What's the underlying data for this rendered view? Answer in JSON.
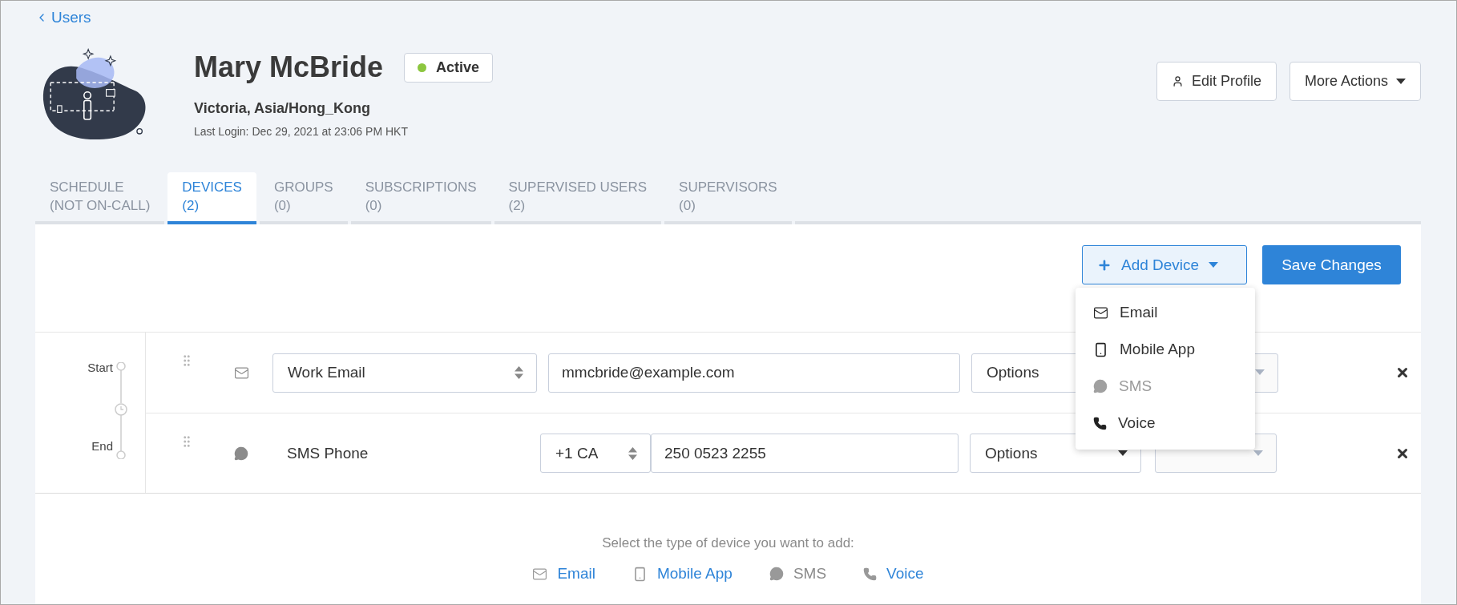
{
  "back_link": "Users",
  "profile": {
    "name": "Mary McBride",
    "status": {
      "label": "Active",
      "color": "#8cc63f"
    },
    "location": "Victoria, Asia/Hong_Kong",
    "last_login": "Last Login: Dec 29, 2021 at 23:06 PM HKT"
  },
  "header_buttons": [
    {
      "label": "Edit Profile",
      "kind": "icon"
    },
    {
      "label": "More Actions",
      "kind": "menu"
    }
  ],
  "tabs": [
    {
      "label": "SCHEDULE",
      "count": "(NOT ON-CALL)",
      "selected": false
    },
    {
      "label": "DEVICES",
      "count": "(2)",
      "selected": true
    },
    {
      "label": "GROUPS",
      "count": "(0)",
      "selected": false
    },
    {
      "label": "SUBSCRIPTIONS",
      "count": "(0)",
      "selected": false
    },
    {
      "label": "SUPERVISED USERS",
      "count": "(2)",
      "selected": false
    },
    {
      "label": "SUPERVISORS",
      "count": "(0)",
      "selected": false
    }
  ],
  "toolbar": {
    "add_button": "Add Device",
    "save_button": "Save Changes",
    "menu_expanded": true
  },
  "add_menu": [
    {
      "label": "Email",
      "kind": "email",
      "disabled": false
    },
    {
      "label": "Mobile App",
      "kind": "mobile",
      "disabled": false
    },
    {
      "label": "SMS",
      "kind": "sms",
      "disabled": true
    },
    {
      "label": "Voice",
      "kind": "voice",
      "disabled": false
    }
  ],
  "timeline": {
    "start": "Start",
    "end": "End"
  },
  "devices": [
    {
      "kind": "email",
      "name": "Work Email",
      "value": "mmcbride@example.com",
      "options": "Options"
    },
    {
      "kind": "sms",
      "name": "SMS Phone",
      "country": "+1 CA",
      "value": "250 0523 2255",
      "options": "Options"
    }
  ],
  "add_prompt": "Select the type of device you want to add:",
  "add_links": [
    {
      "label": "Email",
      "kind": "email",
      "disabled": false
    },
    {
      "label": "Mobile App",
      "kind": "mobile",
      "disabled": false
    },
    {
      "label": "SMS",
      "kind": "sms",
      "disabled": true
    },
    {
      "label": "Voice",
      "kind": "voice",
      "disabled": false
    }
  ]
}
